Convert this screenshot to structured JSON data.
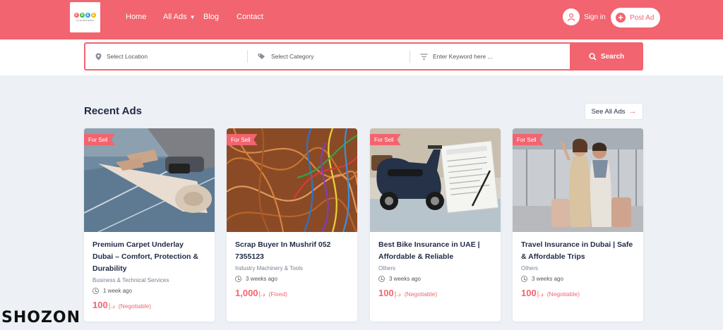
{
  "brand": {
    "logo_letters": [
      "F",
      "R",
      "E",
      "E"
    ],
    "logo_colors": [
      "#f2646f",
      "#3bb54a",
      "#2f9be0",
      "#f5b400"
    ],
    "logo_sub": "CLASSIFIEDS",
    "accent": "#f2646f"
  },
  "nav": {
    "home": "Home",
    "all_ads": "All Ads",
    "blog": "Blog",
    "contact": "Contact"
  },
  "account": {
    "sign_in": "Sign in",
    "post_ad": "Post Ad"
  },
  "search": {
    "location_placeholder": "Select Location",
    "category_placeholder": "Select Category",
    "keyword_placeholder": "Enter Keyword here ...",
    "button": "Search"
  },
  "section": {
    "title": "Recent Ads",
    "see_all": "See All Ads"
  },
  "cards": [
    {
      "tag": "For Sell",
      "title": "Premium Carpet Underlay Dubai – Comfort, Protection & Durability",
      "category": "Business & Technical Services",
      "time": "1 week ago",
      "price": "100",
      "currency": "د.إ",
      "note": "(Negotiable)"
    },
    {
      "tag": "For Sell",
      "title": "Scrap Buyer In Mushrif 052 7355123",
      "category": "Industry Machinery & Tools",
      "time": "3 weeks ago",
      "price": "1,000",
      "currency": "د.إ",
      "note": "(Fixed)"
    },
    {
      "tag": "For Sell",
      "title": "Best Bike Insurance in UAE | Affordable & Reliable",
      "category": "Others",
      "time": "3 weeks ago",
      "price": "100",
      "currency": "د.إ",
      "note": "(Negotiable)"
    },
    {
      "tag": "For Sell",
      "title": "Travel Insurance in Dubai | Safe & Affordable Trips",
      "category": "Others",
      "time": "3 weeks ago",
      "price": "100",
      "currency": "د.إ",
      "note": "(Negotiable)"
    }
  ],
  "watermark": "SHOZON"
}
